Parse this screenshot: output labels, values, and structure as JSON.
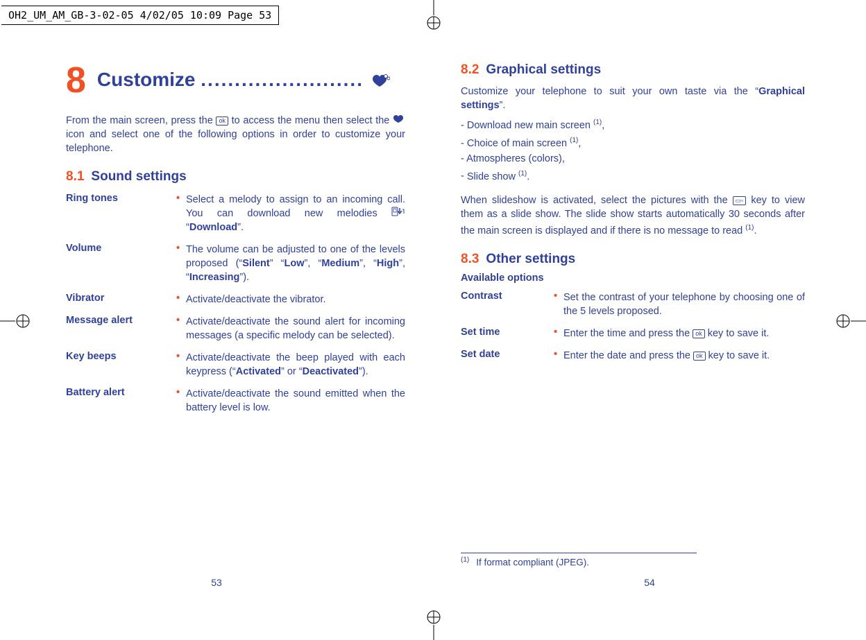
{
  "print_header": "OH2_UM_AM_GB-3-02-05  4/02/05  10:09  Page 53",
  "left": {
    "chapter_number": "8",
    "chapter_title": "Customize",
    "chapter_title_dots": "........................",
    "intro_pre": "From the main screen, press the ",
    "ok_label": "ok",
    "intro_mid": " to access the menu then select the ",
    "intro_post": " icon and select one of the following options in order to customize your telephone.",
    "sec81_num": "8.1",
    "sec81_title": "Sound settings",
    "rows": [
      {
        "term": "Ring tones",
        "desc_parts": [
          "Select a melody to assign to an incoming call. You can download new melodies "
        ],
        "desc_trail": " “",
        "bold_trail": "Download",
        "close": "”."
      },
      {
        "term": "Volume",
        "desc_parts": [
          "The volume can be adjusted to one of the levels proposed (“"
        ],
        "sequence": [
          {
            "b": "Silent",
            "after": "” “"
          },
          {
            "b": "Low",
            "after": "”, “"
          },
          {
            "b": "Medium",
            "after": "”, “"
          },
          {
            "b": "High",
            "after": "”, “"
          },
          {
            "b": "Increasing",
            "after": "”)."
          }
        ]
      },
      {
        "term": "Vibrator",
        "plain": "Activate/deactivate the vibrator."
      },
      {
        "term": "Message alert",
        "plain": "Activate/deactivate the sound alert for incoming messages (a specific melody can be selected)."
      },
      {
        "term": "Key beeps",
        "desc_parts": [
          "Activate/deactivate the beep played with each keypress (“"
        ],
        "sequence": [
          {
            "b": "Activated",
            "after": "” or “"
          },
          {
            "b": "Deactivated",
            "after": "”)."
          }
        ]
      },
      {
        "term": "Battery alert",
        "plain": "Activate/deactivate the sound emitted when the battery level is low."
      }
    ],
    "page_number": "53"
  },
  "right": {
    "sec82_num": "8.2",
    "sec82_title": "Graphical settings",
    "sec82_intro_pre": "Customize your telephone to suit your own taste via the “",
    "sec82_intro_bold": "Graphical settings",
    "sec82_intro_post": "”.",
    "sec82_items": [
      {
        "t": "Download new main screen ",
        "sup": "(1)",
        "tail": ","
      },
      {
        "t": "Choice of main screen ",
        "sup": "(1)",
        "tail": ","
      },
      {
        "t": "Atmospheres (colors),",
        "sup": "",
        "tail": ""
      },
      {
        "t": "Slide show ",
        "sup": "(1)",
        "tail": "."
      }
    ],
    "sec82_para_pre": "When slideshow is activated, select the pictures with the ",
    "sec82_para_post": " key to view them as a slide show. The slide show starts automatically 30 seconds after the main screen is displayed and if there is no message to read ",
    "sec82_para_sup": "(1)",
    "sec82_para_tail": ".",
    "sec83_num": "8.3",
    "sec83_title": "Other settings",
    "available": "Available options",
    "rows": [
      {
        "term": "Contrast",
        "plain": "Set the contrast of your telephone by choosing one of the 5 levels proposed."
      },
      {
        "term": "Set time",
        "pre": "Enter the time and press the ",
        "post": " key to save it.",
        "has_ok": true
      },
      {
        "term": "Set date",
        "pre": "Enter the date and press the ",
        "post": " key to save it.",
        "has_ok": true
      }
    ],
    "footnote_mark": "(1)",
    "footnote_text": "If format compliant (JPEG).",
    "page_number": "54"
  }
}
